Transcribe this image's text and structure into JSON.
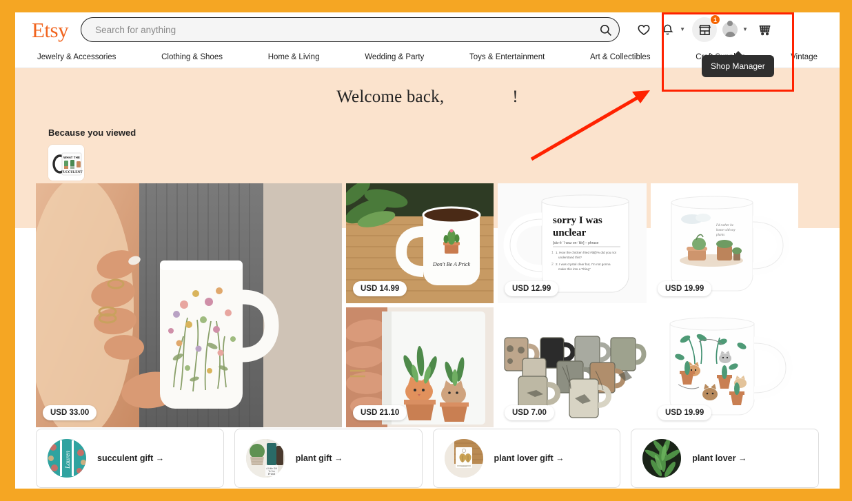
{
  "brand": {
    "logo_text": "Etsy",
    "accent_color": "#F1641E"
  },
  "search": {
    "placeholder": "Search for anything",
    "value": "",
    "icon": "search-icon"
  },
  "header_icons": [
    {
      "name": "favorites-icon",
      "glyph": "heart"
    },
    {
      "name": "notifications-icon",
      "glyph": "bell",
      "caret": "▾"
    },
    {
      "name": "shop-manager-icon",
      "glyph": "storefront",
      "badge": "1"
    },
    {
      "name": "account-icon",
      "glyph": "avatar",
      "caret": "▾"
    },
    {
      "name": "cart-icon",
      "glyph": "cart"
    }
  ],
  "tooltip": {
    "label": "Shop Manager"
  },
  "nav": {
    "items": [
      {
        "label": "Jewelry & Accessories"
      },
      {
        "label": "Clothing & Shoes"
      },
      {
        "label": "Home & Living"
      },
      {
        "label": "Wedding & Party"
      },
      {
        "label": "Toys & Entertainment"
      },
      {
        "label": "Art & Collectibles"
      },
      {
        "label": "Craft Supplies"
      },
      {
        "label": "Vintage"
      }
    ]
  },
  "banner": {
    "welcome_prefix": "Welcome back,",
    "welcome_suffix": "!",
    "viewed_label": "Because you viewed",
    "viewed_thumb_alt": "WHAT THE FUCCULENT mug"
  },
  "products": [
    {
      "price": "USD 33.00",
      "alt": "Hands holding white wildflower mug",
      "span": "tall"
    },
    {
      "price": "USD 14.99",
      "alt": "Don't Be A Prick cactus mug on wood table"
    },
    {
      "price": "USD 12.99",
      "alt": "sorry I was unclear definition mug"
    },
    {
      "price": "USD 19.99",
      "alt": "Cozy reading nook illustration mug"
    },
    {
      "price": "USD 21.10",
      "alt": "Cats and plants illustrated mug"
    },
    {
      "price": "USD 7.00",
      "alt": "Vintage stoneware mug collection"
    },
    {
      "price": "USD 19.99",
      "alt": "Cats with houseplants pattern mug"
    }
  ],
  "suggestions": [
    {
      "label": "succulent gift",
      "arrow": "→",
      "thumb_alt": "Teal patterned tumbler"
    },
    {
      "label": "plant gift",
      "arrow": "→",
      "thumb_alt": "Succulent in knit planter gift set"
    },
    {
      "label": "plant lover gift",
      "arrow": "→",
      "thumb_alt": "Gold leaf earrings on card"
    },
    {
      "label": "plant lover",
      "arrow": "→",
      "thumb_alt": "Green fern houseplant"
    }
  ],
  "annotation": {
    "highlight_color": "#FF2200",
    "border_color": "#F5A623"
  }
}
